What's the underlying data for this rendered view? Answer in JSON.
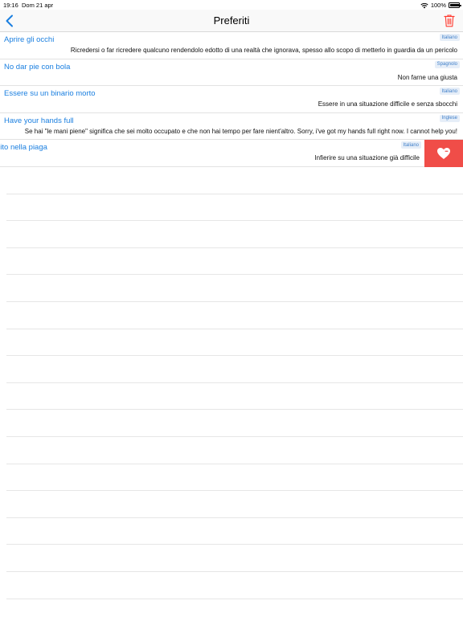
{
  "status": {
    "time": "19:16",
    "date": "Dom 21 apr",
    "battery": "100%"
  },
  "nav": {
    "title": "Preferiti",
    "back_icon": "chevron-left-icon",
    "trash_icon": "trash-icon"
  },
  "colors": {
    "accent": "#1a7fe0",
    "delete": "#f04d48",
    "trash": "#ff3b30"
  },
  "favorites": [
    {
      "term": "Aprire gli occhi",
      "language": "Italiano",
      "meaning": "Ricredersi o far ricredere qualcuno rendendolo edotto di una realtà che ignorava, spesso allo scopo di metterlo in guardia da un pericolo"
    },
    {
      "term": "No dar pie con bola",
      "language": "Spagnolo",
      "meaning": "Non farne una giusta"
    },
    {
      "term": "Essere su un binario morto",
      "language": "Italiano",
      "meaning": "Essere in una situazione difficile e senza sbocchi"
    },
    {
      "term": "Have your hands full",
      "language": "Inglese",
      "meaning": "Se hai \"le mani piene\" significa che sei molto occupato e che non hai tempo per fare nient'altro. Sorry, i've got my hands full right now. I cannot help you!"
    },
    {
      "term": "dito nella piaga",
      "language": "Italiano",
      "meaning": "Infierire su una situazione già difficile"
    }
  ]
}
